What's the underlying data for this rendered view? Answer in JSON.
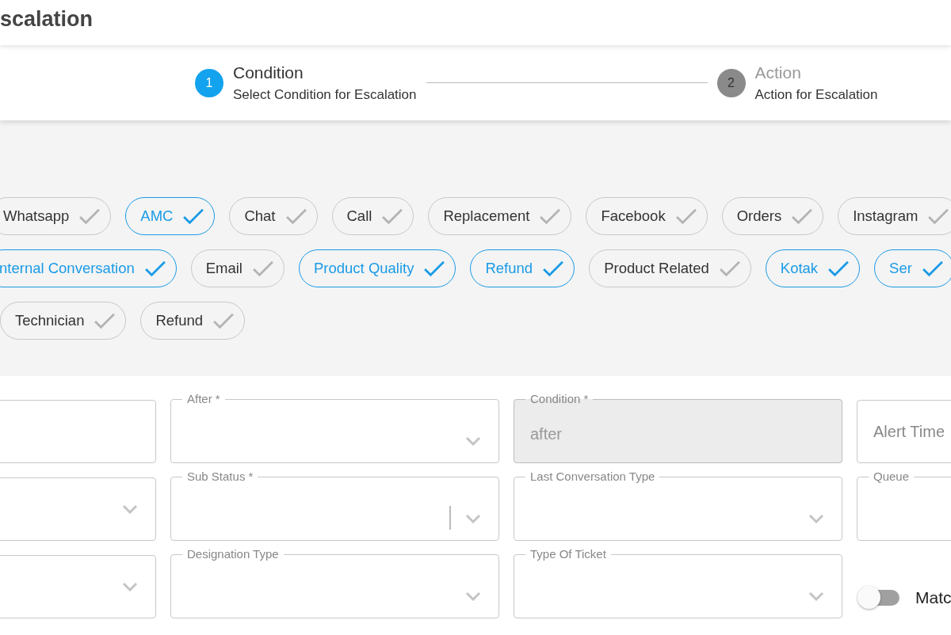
{
  "header": {
    "title": "scalation"
  },
  "stepper": {
    "steps": [
      {
        "number": "1",
        "title": "Condition",
        "subtitle": "Select Condition for Escalation",
        "active": true
      },
      {
        "number": "2",
        "title": "Action",
        "subtitle": "Action for Escalation",
        "active": false
      }
    ]
  },
  "chip_rows": [
    [
      {
        "label": "Whatsapp",
        "selected": false
      },
      {
        "label": "AMC",
        "selected": true
      },
      {
        "label": "Chat",
        "selected": false
      },
      {
        "label": "Call",
        "selected": false
      },
      {
        "label": "Replacement",
        "selected": false
      },
      {
        "label": "Facebook",
        "selected": false
      },
      {
        "label": "Orders",
        "selected": false
      },
      {
        "label": "Instagram",
        "selected": false
      }
    ],
    [
      {
        "label": "nternal Conversation",
        "selected": true
      },
      {
        "label": "Email",
        "selected": false
      },
      {
        "label": "Product Quality",
        "selected": true
      },
      {
        "label": "Refund",
        "selected": true
      },
      {
        "label": "Product Related",
        "selected": false
      },
      {
        "label": "Kotak",
        "selected": true
      },
      {
        "label": "Ser",
        "selected": true
      }
    ],
    [
      {
        "label": "Technician",
        "selected": false
      },
      {
        "label": "Refund",
        "selected": false
      }
    ]
  ],
  "fields": [
    {
      "kind": "text",
      "disabled": false
    },
    {
      "kind": "select",
      "label": "After *",
      "disabled": false
    },
    {
      "kind": "text",
      "label": "Condition *",
      "value": "after",
      "disabled": true
    },
    {
      "kind": "text",
      "placeholder": "Alert Time",
      "disabled": false
    },
    {
      "kind": "select",
      "disabled": false
    },
    {
      "kind": "select",
      "label": "Sub Status *",
      "disabled": false,
      "focused": true
    },
    {
      "kind": "select",
      "label": "Last Conversation Type",
      "disabled": false
    },
    {
      "kind": "text",
      "label": "Queue",
      "disabled": false
    },
    {
      "kind": "select",
      "disabled": false
    },
    {
      "kind": "select",
      "label": "Designation Type",
      "disabled": false
    },
    {
      "kind": "select",
      "label": "Type Of Ticket",
      "disabled": false
    },
    {
      "kind": "toggle",
      "label": "Matc",
      "on": false
    }
  ]
}
